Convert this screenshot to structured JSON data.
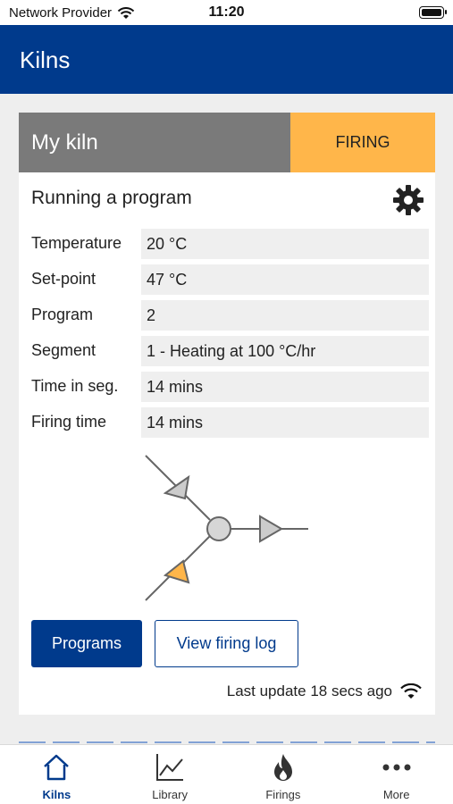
{
  "status_bar": {
    "carrier": "Network Provider",
    "time": "11:20"
  },
  "header": {
    "title": "Kilns"
  },
  "kiln_card": {
    "name": "My kiln",
    "status": "FIRING",
    "status_color": "#ffb64a",
    "activity": "Running a program",
    "rows": [
      {
        "label": "Temperature",
        "value": "20 °C"
      },
      {
        "label": "Set-point",
        "value": "47 °C"
      },
      {
        "label": "Program",
        "value": "2"
      },
      {
        "label": "Segment",
        "value": "1 - Heating at 100 °C/hr"
      },
      {
        "label": "Time in seg.",
        "value": "14 mins"
      },
      {
        "label": "Firing time",
        "value": "14 mins"
      }
    ],
    "buttons": {
      "programs": "Programs",
      "view_log": "View firing log"
    },
    "last_update": "Last update 18 secs ago"
  },
  "tabs": [
    {
      "label": "Kilns",
      "icon": "home-icon",
      "active": true
    },
    {
      "label": "Library",
      "icon": "chart-icon",
      "active": false
    },
    {
      "label": "Firings",
      "icon": "flame-icon",
      "active": false
    },
    {
      "label": "More",
      "icon": "more-icon",
      "active": false
    }
  ],
  "colors": {
    "brand": "#003a8c",
    "active_input_arrow": "#ffb64a",
    "inactive_arrow": "#cccccc"
  }
}
